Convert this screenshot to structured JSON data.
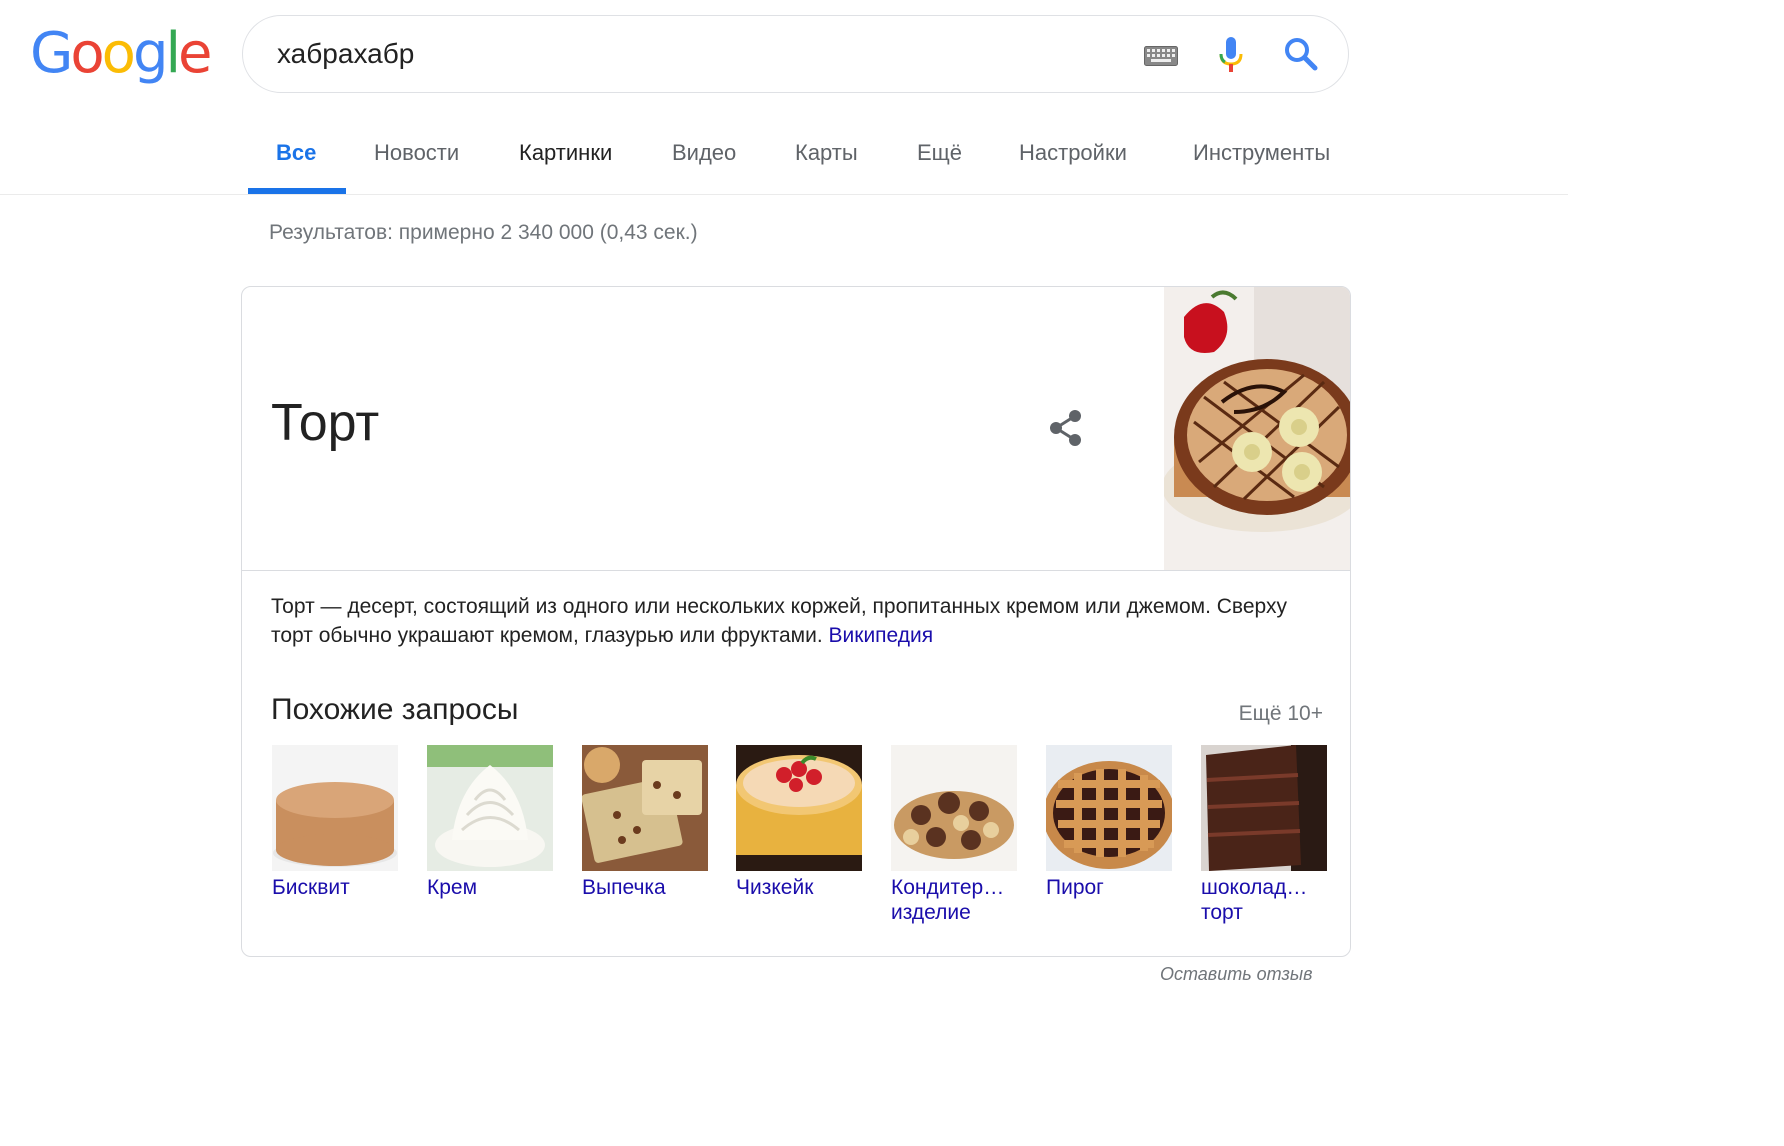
{
  "logo": {
    "letters": [
      "G",
      "o",
      "o",
      "g",
      "l",
      "e"
    ],
    "colors": [
      "#4285F4",
      "#EA4335",
      "#FBBC05",
      "#4285F4",
      "#34A853",
      "#EA4335"
    ]
  },
  "search": {
    "query": "хабрахабр"
  },
  "icons": {
    "keyboard": "keyboard-icon",
    "mic": "mic-icon",
    "search": "search-icon",
    "share": "share-icon"
  },
  "tabs": [
    {
      "label": "Все"
    },
    {
      "label": "Новости"
    },
    {
      "label": "Картинки"
    },
    {
      "label": "Видео"
    },
    {
      "label": "Карты"
    },
    {
      "label": "Ещё"
    },
    {
      "label": "Настройки"
    },
    {
      "label": "Инструменты"
    }
  ],
  "stats": "Результатов: примерно 2 340 000 (0,43 сек.)",
  "panel": {
    "title": "Торт",
    "description": "Торт — десерт, состоящий из одного или нескольких коржей, пропитанных кремом или джемом. Сверху торт обычно украшают кремом, глазурью или фруктами.",
    "source_link": "Википедия",
    "related_title": "Похожие запросы",
    "more_link": "Ещё 10+",
    "related": [
      {
        "label": "Бисквит"
      },
      {
        "label": "Крем"
      },
      {
        "label": "Выпечка"
      },
      {
        "label": "Чизкейк"
      },
      {
        "label": "Кондитер… изделие"
      },
      {
        "label": "Пирог"
      },
      {
        "label": "шоколад… торт"
      }
    ]
  },
  "feedback": "Оставить отзыв",
  "colors": {
    "accent": "#1a73e8",
    "link": "#1a0dab",
    "muted": "#70757a"
  }
}
